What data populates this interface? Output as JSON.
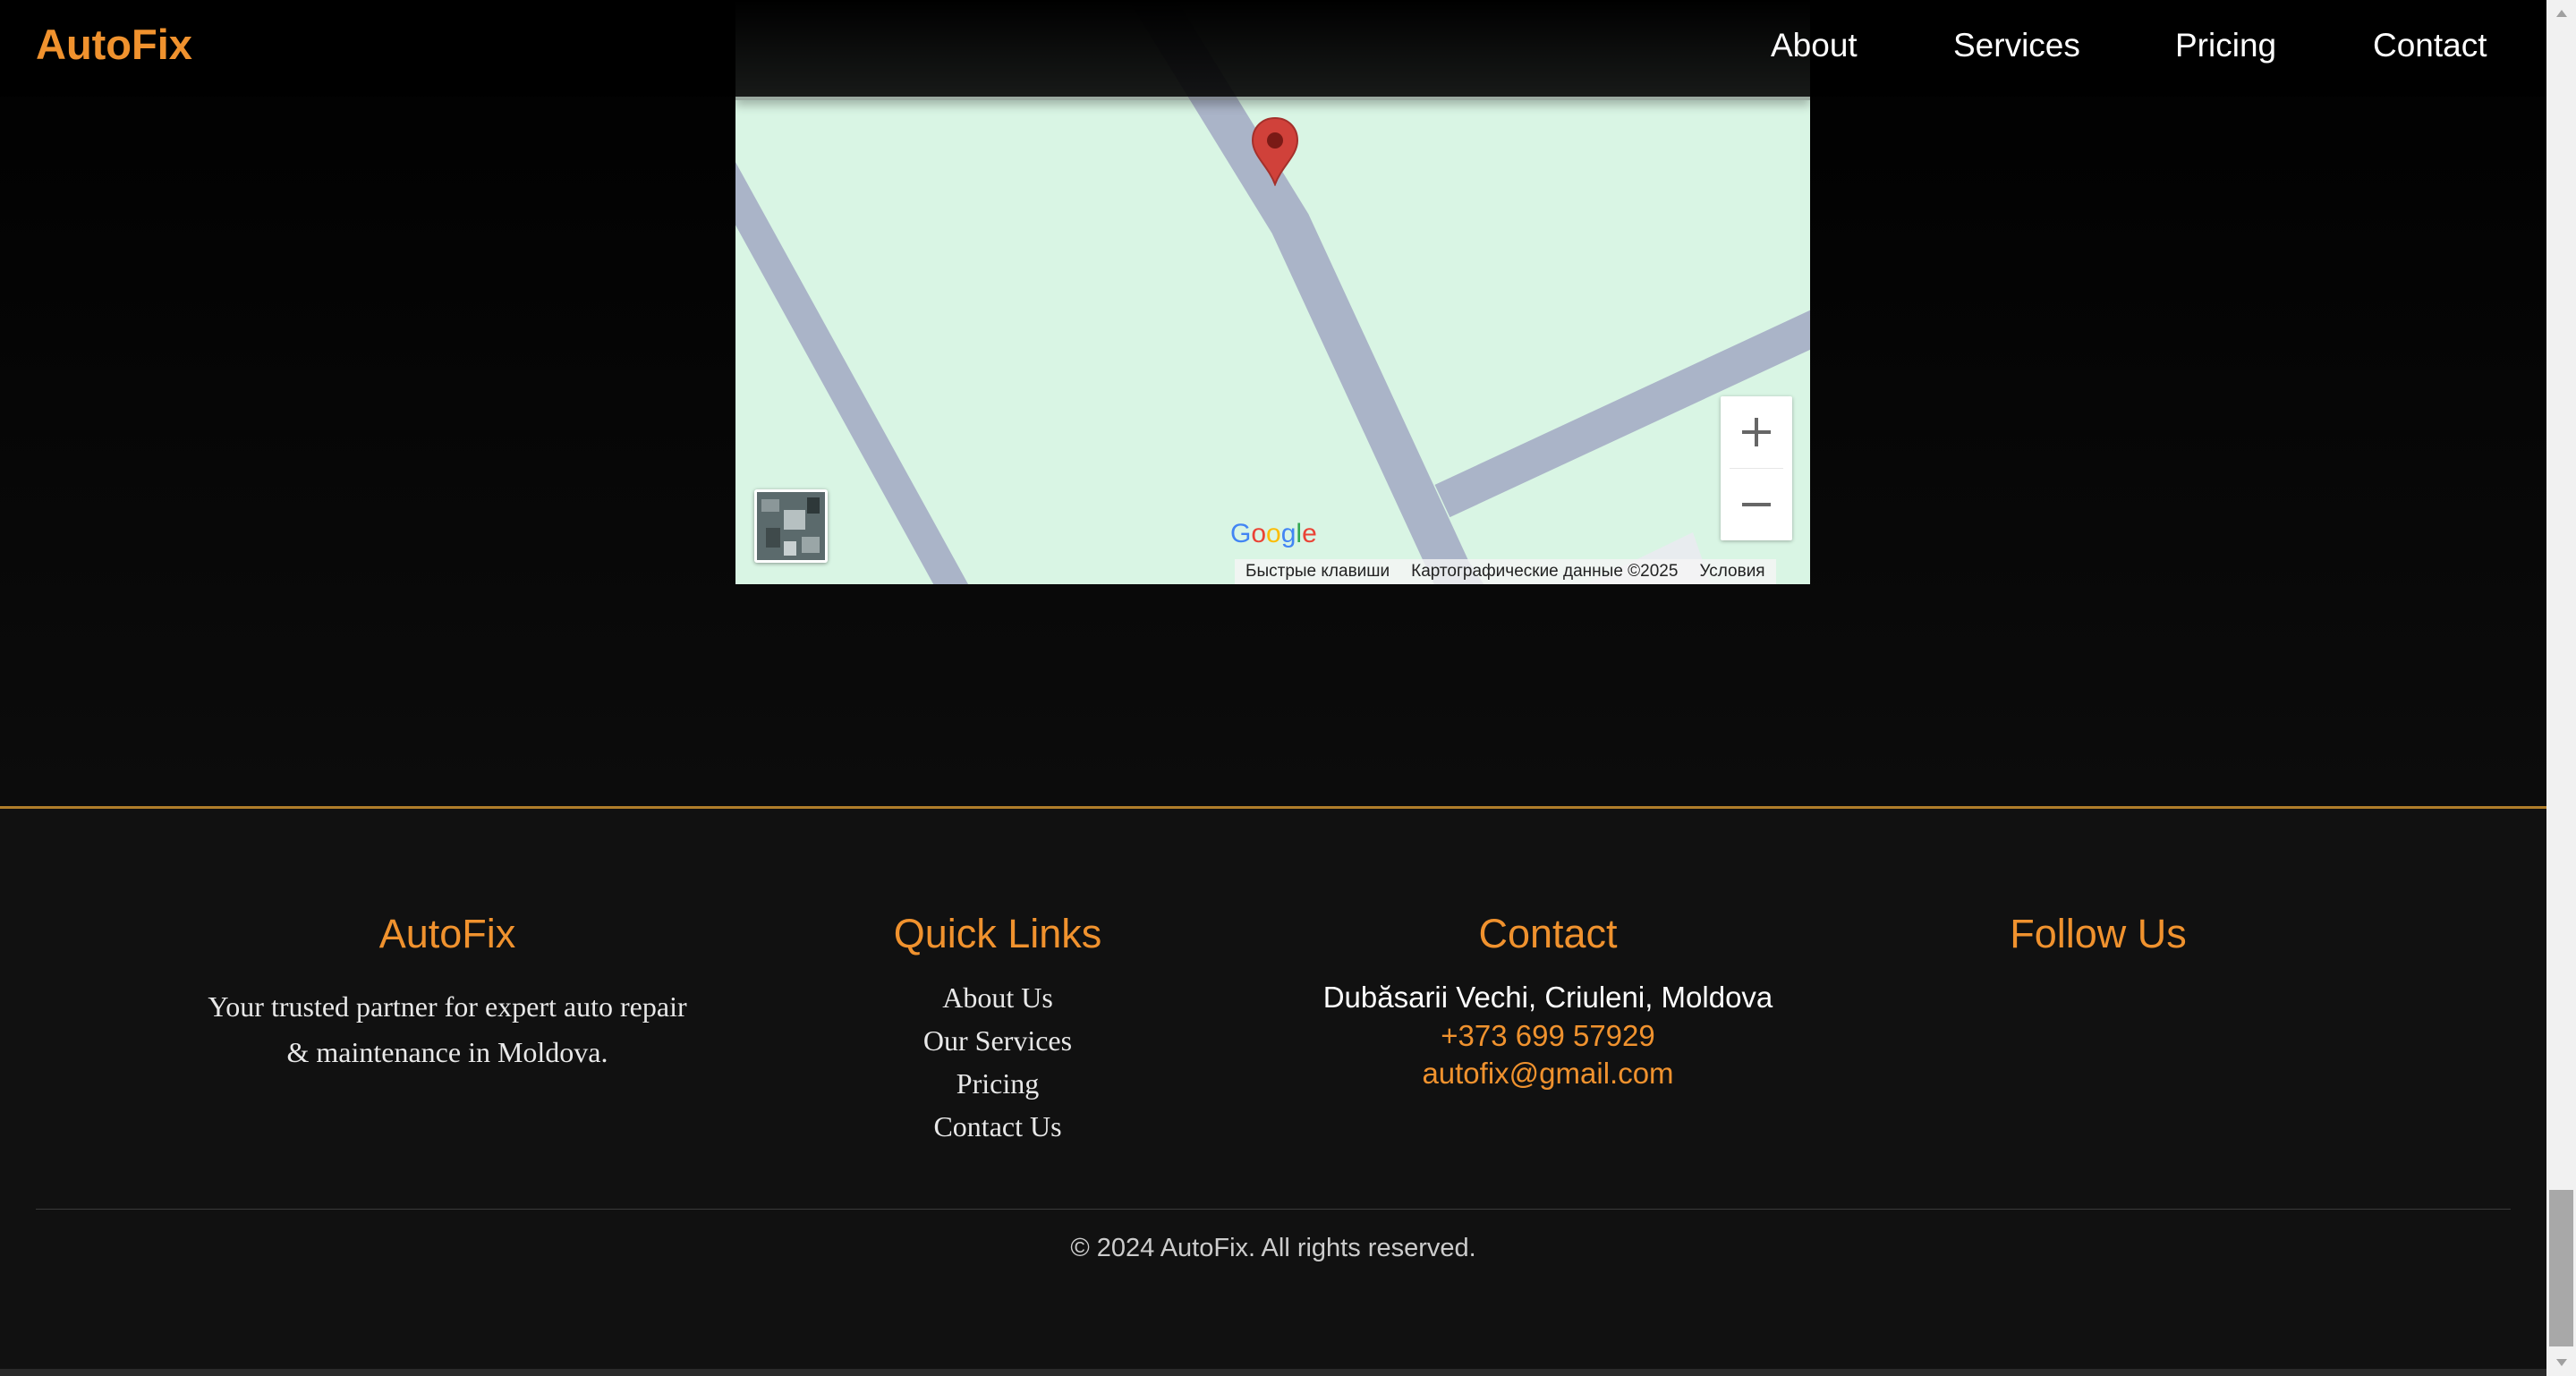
{
  "header": {
    "logo": "AutoFix",
    "nav": [
      "About",
      "Services",
      "Pricing",
      "Contact"
    ]
  },
  "map": {
    "google_logo": "Google",
    "attribution": {
      "shortcuts": "Быстрые клавиши",
      "map_data": "Картографические данные ©2025",
      "terms": "Условия"
    },
    "controls": {
      "zoom_in": "zoom-in-icon",
      "zoom_out": "zoom-out-icon",
      "layer": "satellite-layer-thumbnail"
    },
    "colors": {
      "land": "#d9f5e4",
      "road": "#aab4c8",
      "marker": "#d0413a"
    }
  },
  "footer": {
    "about": {
      "title": "AutoFix",
      "tagline_line1": "Your trusted partner for expert auto repair",
      "tagline_line2": "& maintenance in Moldova."
    },
    "quick_links": {
      "title": "Quick Links",
      "items": [
        "About Us",
        "Our Services",
        "Pricing",
        "Contact Us"
      ]
    },
    "contact": {
      "title": "Contact",
      "address": "Dubăsarii Vechi, Criuleni, Moldova",
      "phone": "+373 699 57929",
      "email": "autofix@gmail.com"
    },
    "follow": {
      "title": "Follow Us"
    },
    "copyright": "© 2024 AutoFix. All rights reserved."
  },
  "colors": {
    "accent": "#f0922e",
    "background": "#111111",
    "divider": "#b07d2a"
  }
}
